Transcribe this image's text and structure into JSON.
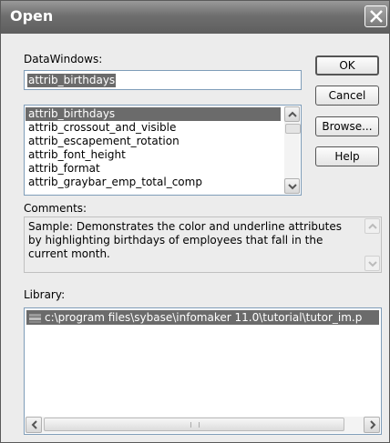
{
  "dialog": {
    "title": "Open",
    "close_icon": "close-icon"
  },
  "datawindows": {
    "label": "DataWindows:",
    "value": "attrib_birthdays",
    "items": [
      "attrib_birthdays",
      "attrib_crossout_and_visible",
      "attrib_escapement_rotation",
      "attrib_font_height",
      "attrib_format",
      "attrib_graybar_emp_total_comp"
    ]
  },
  "buttons": {
    "ok": "OK",
    "cancel": "Cancel",
    "browse": "Browse...",
    "help": "Help"
  },
  "comments": {
    "label": "Comments:",
    "line1": "Sample: Demonstrates the color and underline attributes",
    "line2": "by highlighting birthdays of employees that fall in the",
    "line3": "current month."
  },
  "library": {
    "label": "Library:",
    "items": [
      "c:\\program files\\sybase\\infomaker 11.0\\tutorial\\tutor_im.p"
    ],
    "library_icon": "library-icon"
  },
  "colors": {
    "titlebar": "#6e6e6e",
    "selection": "#6b6b6b",
    "dialog_bg": "#ececec"
  }
}
